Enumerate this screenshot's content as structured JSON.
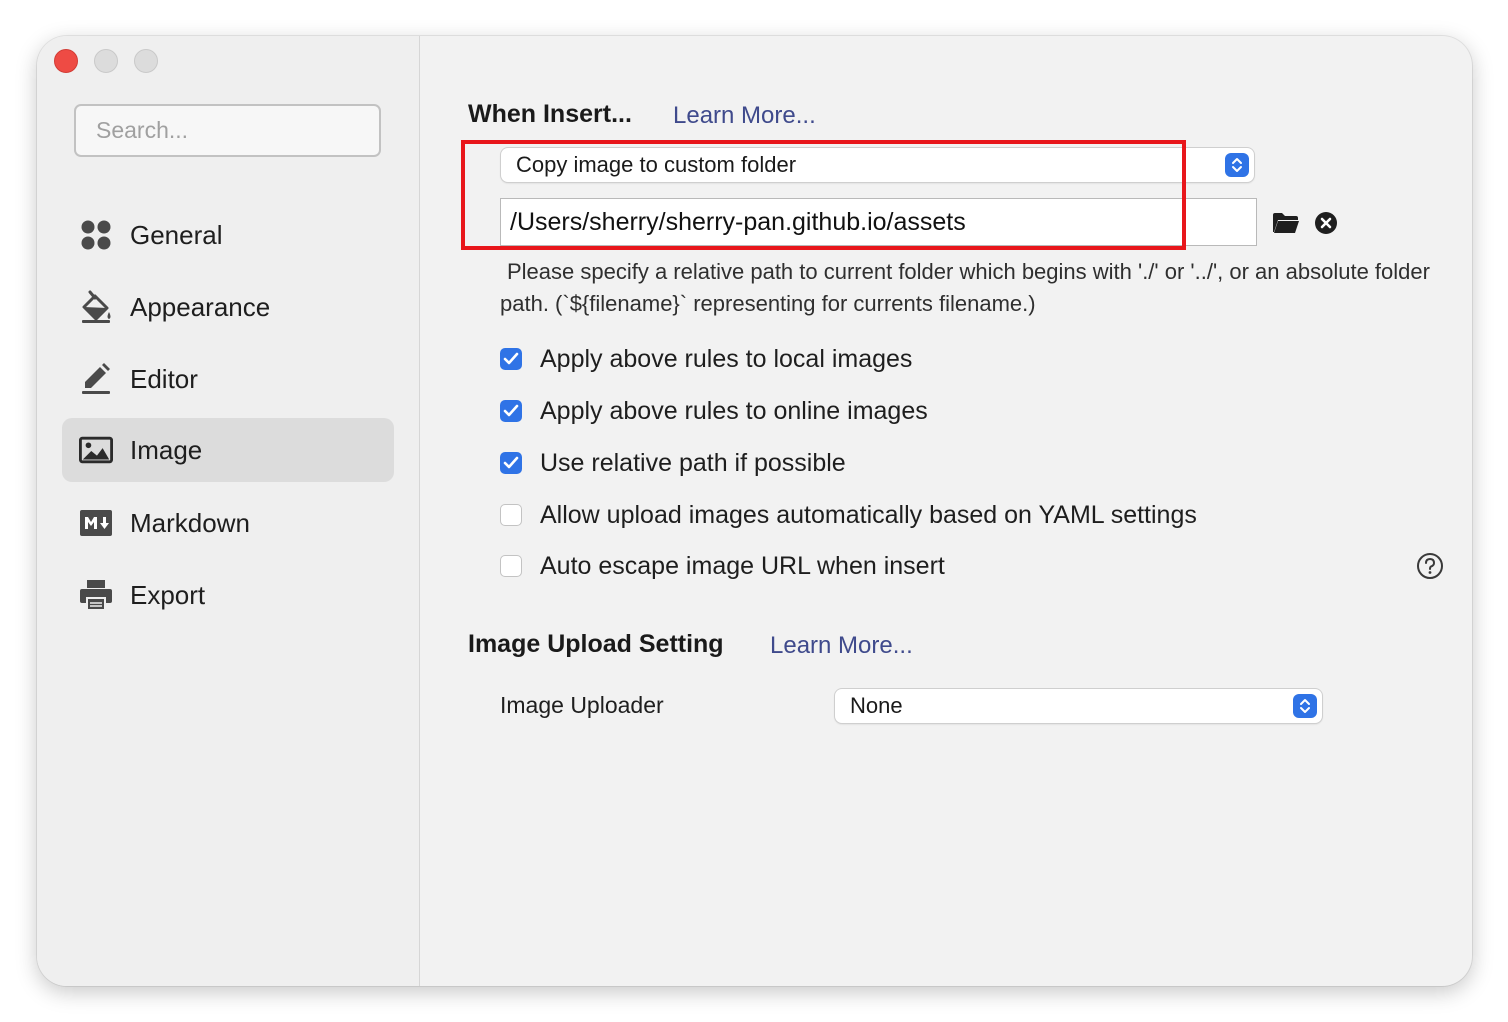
{
  "sidebar": {
    "search_placeholder": "Search...",
    "items": [
      {
        "label": "General",
        "icon": "general-grid-icon"
      },
      {
        "label": "Appearance",
        "icon": "paint-bucket-icon"
      },
      {
        "label": "Editor",
        "icon": "pencil-icon"
      },
      {
        "label": "Image",
        "icon": "image-icon",
        "active": true
      },
      {
        "label": "Markdown",
        "icon": "markdown-icon"
      },
      {
        "label": "Export",
        "icon": "printer-icon"
      }
    ]
  },
  "when_insert": {
    "heading": "When Insert...",
    "learn_more": "Learn More...",
    "action_select": "Copy image to custom folder",
    "folder_path": "/Users/sherry/sherry-pan.github.io/assets",
    "hint": "Please specify a relative path to current folder which begins with './' or '../', or an absolute folder path. (`${filename}` representing for currents filename.)"
  },
  "options": [
    {
      "label": "Apply above rules to local images",
      "checked": true
    },
    {
      "label": "Apply above rules to online images",
      "checked": true
    },
    {
      "label": "Use relative path if possible",
      "checked": true
    },
    {
      "label": "Allow upload images automatically based on YAML settings",
      "checked": false
    },
    {
      "label": "Auto escape image URL when insert",
      "checked": false
    }
  ],
  "upload": {
    "heading": "Image Upload Setting",
    "learn_more": "Learn More...",
    "uploader_label": "Image Uploader",
    "uploader_value": "None"
  },
  "colors": {
    "accent": "#2f73e6",
    "link": "#3f4a8c",
    "highlight_box": "#e8161b"
  }
}
